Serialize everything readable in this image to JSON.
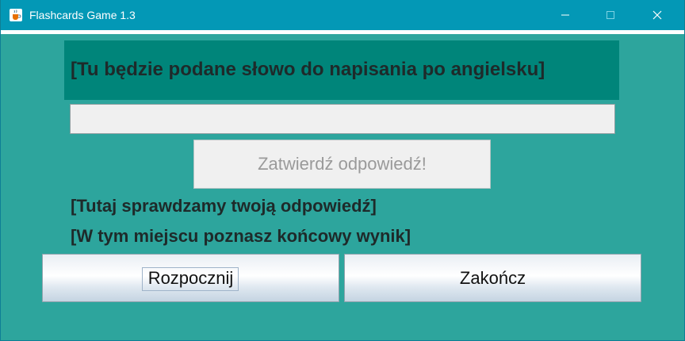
{
  "window": {
    "title": "Flashcards Game 1.3",
    "icons": {
      "app": "java-cup-icon",
      "minimize": "minimize-icon",
      "maximize": "maximize-icon",
      "close": "close-icon"
    }
  },
  "game": {
    "prompt": "[Tu będzie podane słowo do napisania po angielsku]",
    "answer_value": "",
    "confirm_label": "Zatwierdź odpowiedź!",
    "feedback": "[Tutaj sprawdzamy twoją odpowiedź]",
    "result": "[W tym miejscu poznasz końcowy wynik]",
    "start_label": "Rozpocznij",
    "end_label": "Zakończ"
  },
  "colors": {
    "background": "#2da59d",
    "prompt_box": "#00857a",
    "titlebar": "#0398b6"
  }
}
